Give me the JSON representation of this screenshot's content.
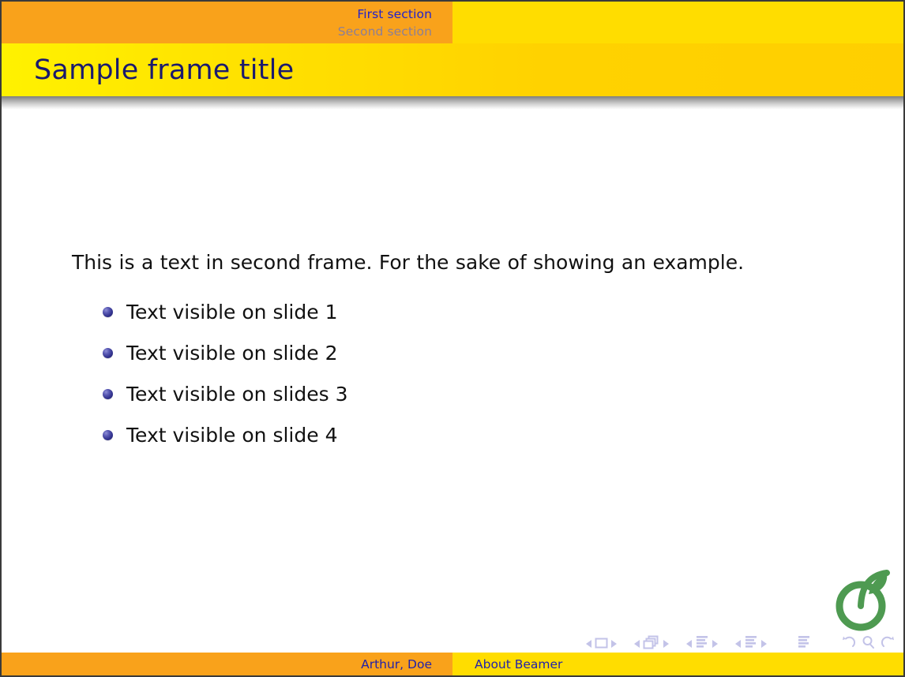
{
  "slide": {
    "frame_title": "Sample frame title",
    "body_paragraph": "This is a text in second frame.  For the sake of showing an example.",
    "bullets": [
      "Text visible on slide 1",
      "Text visible on slide 2",
      "Text visible on slides 3",
      "Text visible on slide 4"
    ]
  },
  "header": {
    "sections": [
      {
        "label": "First section",
        "state": "active"
      },
      {
        "label": "Second section",
        "state": "inactive"
      }
    ]
  },
  "footer": {
    "author": "Arthur, Doe",
    "title": "About Beamer"
  },
  "navigation": {
    "slide_prev": "prev-slide",
    "slide_icon": "slide-icon",
    "slide_next": "next-slide",
    "frame_prev": "prev-frame",
    "frame_icon": "frames-icon",
    "frame_next": "next-frame",
    "subsection_prev": "prev-subsection",
    "subsection_icon": "subsection-icon",
    "subsection_next": "next-subsection",
    "section_prev": "prev-section",
    "section_icon": "section-icon",
    "section_next": "next-section",
    "presentation_icon": "presentation-icon",
    "back_icon": "back-icon",
    "search_icon": "search-icon",
    "forward_icon": "forward-icon"
  },
  "logo": {
    "name": "overleaf-logo",
    "color": "#4e9a51"
  },
  "colors": {
    "header_orange": "#f9a21b",
    "header_yellow": "#ffdd00",
    "title_yellow": "#ffe400",
    "title_text": "#1a1a6e",
    "section_active": "#2222cc",
    "section_inactive": "#8c7f96",
    "bullet": "#33338f",
    "body_text": "#111111",
    "nav_symbol": "#c3c3e8"
  }
}
